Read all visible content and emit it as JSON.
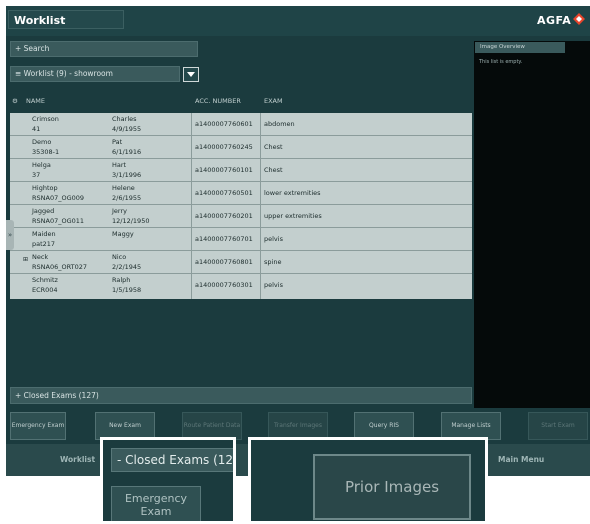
{
  "app": {
    "title": "Worklist",
    "brand": "AGFA",
    "colors": {
      "background": "#1b3b3e",
      "grid": "#c3cfce",
      "brand_accent": "#e8452c"
    }
  },
  "search": {
    "label": "Search"
  },
  "worklist_selector": {
    "label": "Worklist (9) - showroom"
  },
  "table": {
    "columns": [
      "NAME",
      "ACC. NUMBER",
      "EXAM"
    ],
    "rows": [
      {
        "marker": "",
        "last": "Crimson",
        "id": "41",
        "first": "Charles",
        "dob": "4/9/1955",
        "acc": "a1400007760601",
        "exam": "abdomen"
      },
      {
        "marker": "",
        "last": "Demo",
        "id": "35308-1",
        "first": "Pat",
        "dob": "6/1/1916",
        "acc": "a1400007760245",
        "exam": "Chest"
      },
      {
        "marker": "",
        "last": "Helga",
        "id": "37",
        "first": "Hart",
        "dob": "3/1/1996",
        "acc": "a1400007760101",
        "exam": "Chest"
      },
      {
        "marker": "",
        "last": "Hightop",
        "id": "RSNA07_OG009",
        "first": "Helene",
        "dob": "2/6/1955",
        "acc": "a1400007760501",
        "exam": "lower extremities"
      },
      {
        "marker": "",
        "last": "Jagged",
        "id": "RSNA07_OG011",
        "first": "Jerry",
        "dob": "12/12/1950",
        "acc": "a1400007760201",
        "exam": "upper extremities"
      },
      {
        "marker": "",
        "last": "Maiden",
        "id": "pat217",
        "first": "Maggy",
        "dob": "",
        "acc": "a1400007760701",
        "exam": "pelvis"
      },
      {
        "marker": "",
        "last": "Neck",
        "id": "RSNA06_ORT027",
        "first": "Nico",
        "dob": "2/2/1945",
        "acc": "a1400007760801",
        "exam": "spine"
      },
      {
        "marker": "",
        "last": "Schmitz",
        "id": "ECR004",
        "first": "Ralph",
        "dob": "1/5/1958",
        "acc": "a1400007760301",
        "exam": "pelvis"
      }
    ]
  },
  "image_overview": {
    "title": "Image Overview",
    "empty_text": "This list is empty."
  },
  "closed_exams": {
    "label": "Closed Exams (127)"
  },
  "buttons": {
    "emergency": "Emergency Exam",
    "new_exam": "New Exam",
    "rerun": "Route Patient Data",
    "transfer": "Transfer Images",
    "query_ris": "Query RIS",
    "manage_lists": "Manage Lists",
    "start_exam": "Start Exam"
  },
  "bottom_nav": {
    "worklist": "Worklist",
    "main_menu": "Main Menu"
  },
  "zoom_callouts": {
    "closed_exams_partial": "Closed Exams (12",
    "emergency_exam": "Emergency Exam",
    "prior_images": "Prior Images"
  }
}
